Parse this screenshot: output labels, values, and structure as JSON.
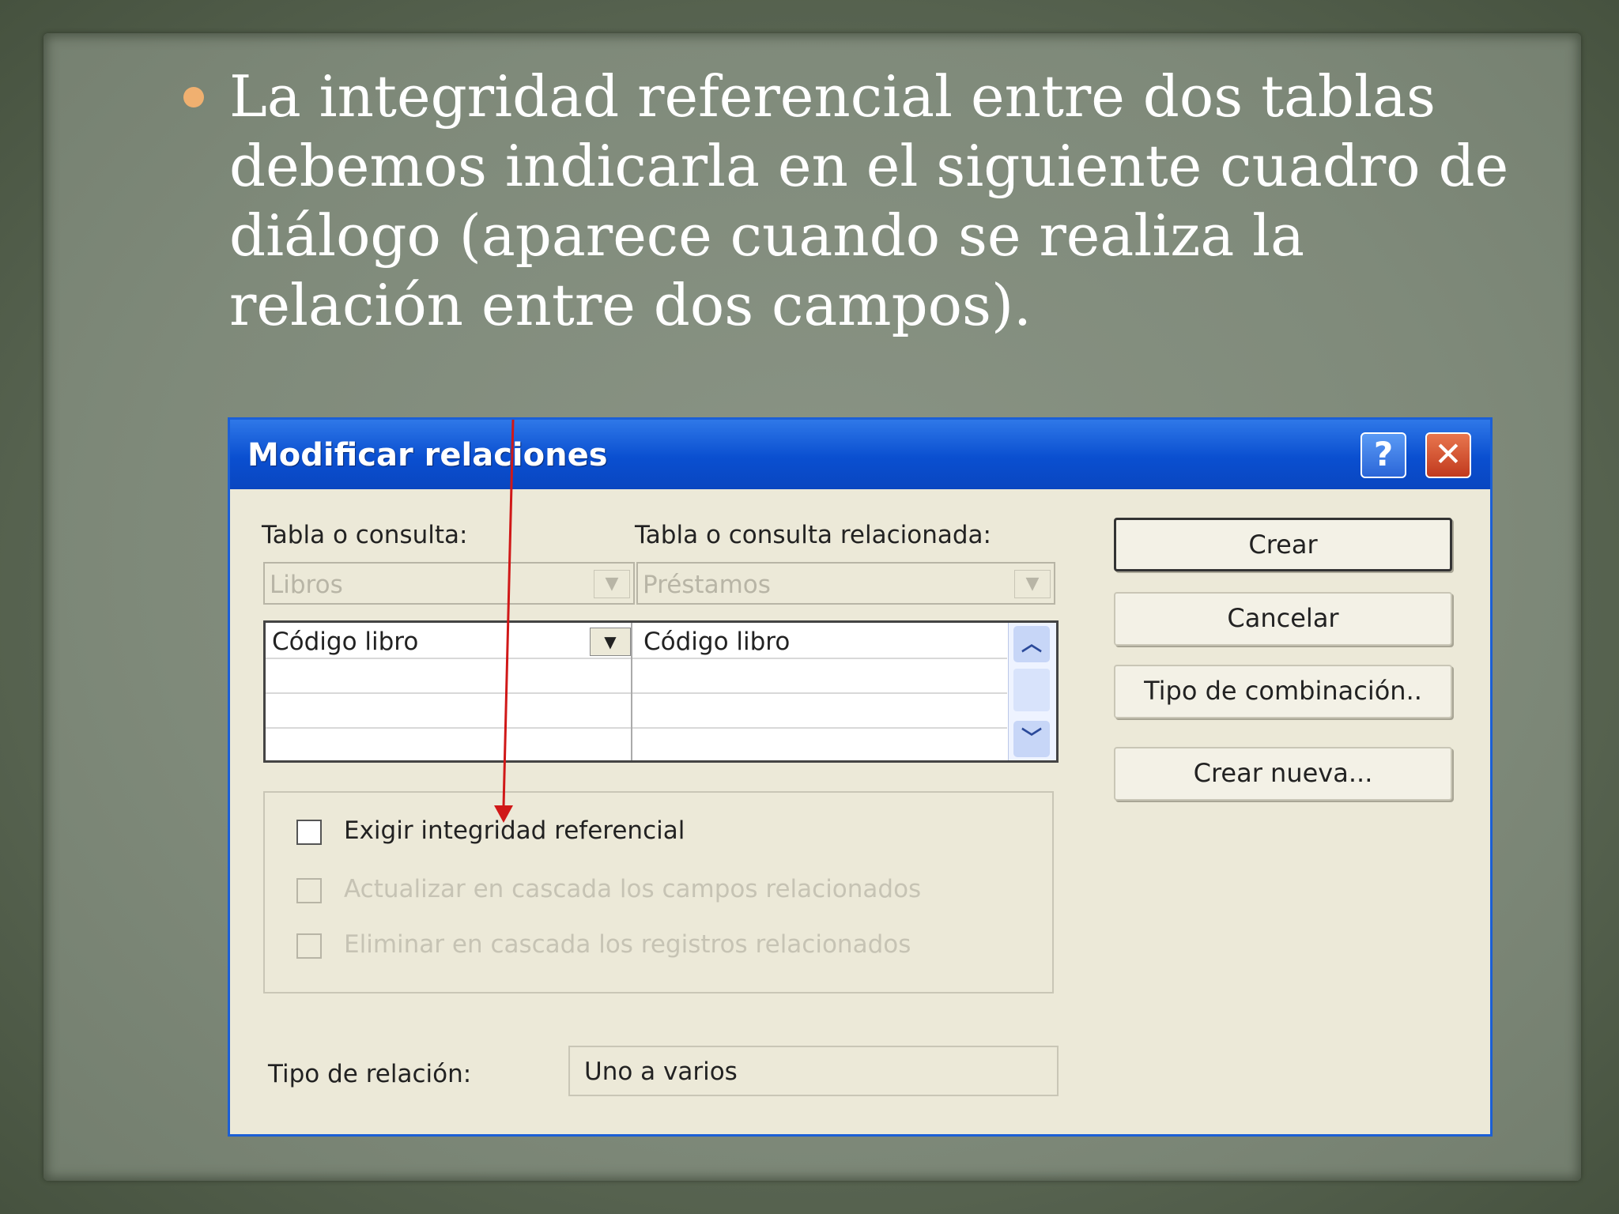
{
  "slide": {
    "text": "La integridad referencial entre dos tablas debemos indicarla en el siguiente cuadro de diálogo (aparece cuando se realiza la relación entre dos campos)."
  },
  "dialog": {
    "title": "Modificar relaciones",
    "help_label": "?",
    "close_label": "✕",
    "table_label": "Tabla o consulta:",
    "related_table_label": "Tabla o consulta relacionada:",
    "table_value": "Libros",
    "related_table_value": "Préstamos",
    "field_left": "Código libro",
    "field_right": "Código libro",
    "checkboxes": [
      {
        "label": "Exigir integridad referencial",
        "enabled": true,
        "checked": false
      },
      {
        "label": "Actualizar en cascada los campos relacionados",
        "enabled": false,
        "checked": false
      },
      {
        "label": "Eliminar en cascada los registros relacionados",
        "enabled": false,
        "checked": false
      }
    ],
    "buttons": {
      "create": "Crear",
      "cancel": "Cancelar",
      "join_type": "Tipo de combinación..",
      "create_new": "Crear nueva..."
    },
    "relation_type_label": "Tipo de relación:",
    "relation_type_value": "Uno a varios"
  },
  "colors": {
    "titlebar": "#0a4fd0",
    "dialog_bg": "#ece9d8",
    "arrow": "#d01818",
    "bullet": "#f0b070"
  }
}
